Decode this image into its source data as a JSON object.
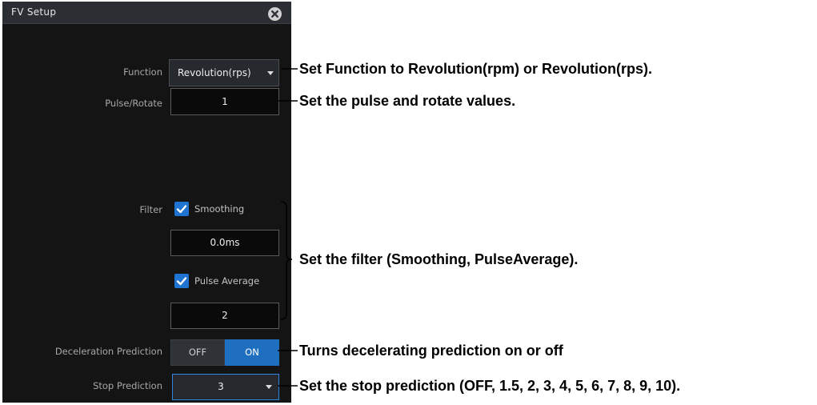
{
  "dialog": {
    "title": "FV Setup",
    "close_icon": "close-icon"
  },
  "function": {
    "label": "Function",
    "value": "Revolution(rps)"
  },
  "pulse_rotate": {
    "label": "Pulse/Rotate",
    "value": "1"
  },
  "filter": {
    "label": "Filter",
    "smoothing": {
      "label": "Smoothing",
      "checked": true,
      "value": "0.0ms"
    },
    "pulse_average": {
      "label": "Pulse Average",
      "checked": true,
      "value": "2"
    }
  },
  "deceleration_prediction": {
    "label": "Deceleration Prediction",
    "off_label": "OFF",
    "on_label": "ON",
    "selected": "ON"
  },
  "stop_prediction": {
    "label": "Stop Prediction",
    "value": "3"
  },
  "callouts": {
    "function": "Set Function to Revolution(rpm) or Revolution(rps).",
    "pulse_rotate": "Set the pulse and rotate values.",
    "filter": "Set the filter (Smoothing, PulseAverage).",
    "deceleration": "Turns decelerating prediction on or off",
    "stop": "Set the stop prediction (OFF, 1.5, 2, 3, 4, 5, 6, 7, 8, 9, 10)."
  },
  "colors": {
    "panel_bg": "#141414",
    "accent_blue": "#1f6fc0"
  }
}
